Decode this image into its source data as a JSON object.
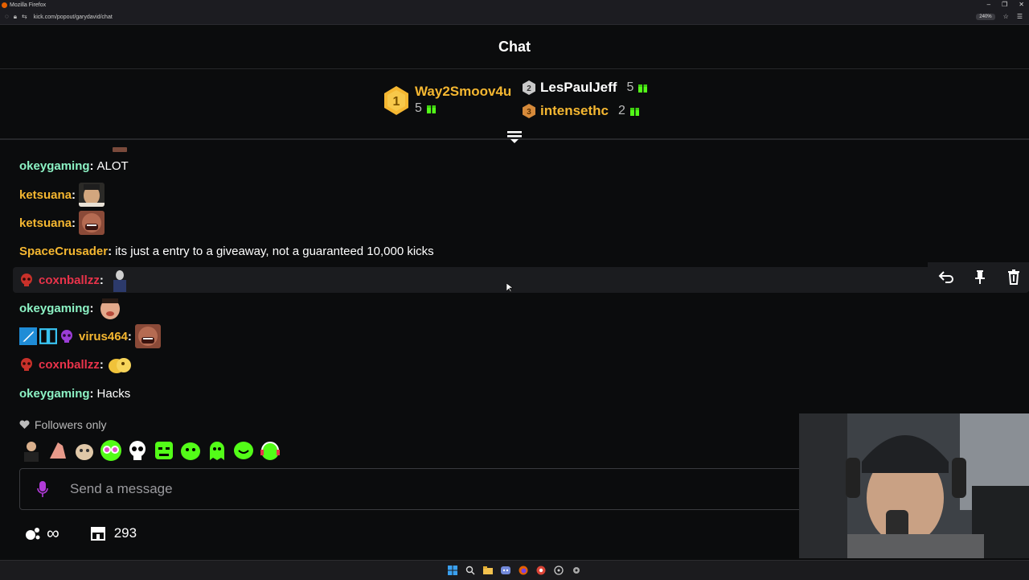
{
  "browser": {
    "window_title": "Mozilla Firefox",
    "url": "kick.com/popout/garydavid/chat",
    "zoom": "240%"
  },
  "chat": {
    "title": "Chat"
  },
  "leaderboard": {
    "first": {
      "rank": "1",
      "name": "Way2Smoov4u",
      "count": "5",
      "color": "#f5b731"
    },
    "second": {
      "rank": "2",
      "name": "LesPaulJeff",
      "count": "5",
      "color": "#ffffff"
    },
    "third": {
      "rank": "3",
      "name": "intensethc",
      "count": "2",
      "color": "#f5b731"
    },
    "gift_color": "#53fc18"
  },
  "messages": [
    {
      "user": "okeygaming",
      "text": "ALOT",
      "color": "#8cf2c4"
    },
    {
      "user": "ketsuana",
      "emote": "face-emote",
      "color": "#f5b731"
    },
    {
      "user": "ketsuana",
      "emote": "screaming-face-emote",
      "color": "#f5b731"
    },
    {
      "user": "SpaceCrusader",
      "text": "its just a entry to a giveaway, not a guaranteed 10,000 kicks",
      "color": "#f5b731"
    },
    {
      "user": "coxnballzz",
      "emote": "guy-emote",
      "color": "#e8334a"
    },
    {
      "user": "okeygaming",
      "emote": "face-emote",
      "color": "#8cf2c4"
    },
    {
      "user": "virus464",
      "emote": "screaming-face-emote",
      "color": "#f5b731"
    },
    {
      "user": "coxnballzz",
      "emote": "yellow-blob-emote",
      "color": "#e8334a"
    },
    {
      "user": "okeygaming",
      "text": "Hacks",
      "color": "#8cf2c4"
    }
  ],
  "chat_mode": "Followers only",
  "input": {
    "placeholder": "Send a message"
  },
  "footer": {
    "points": "∞",
    "store_count": "293"
  }
}
